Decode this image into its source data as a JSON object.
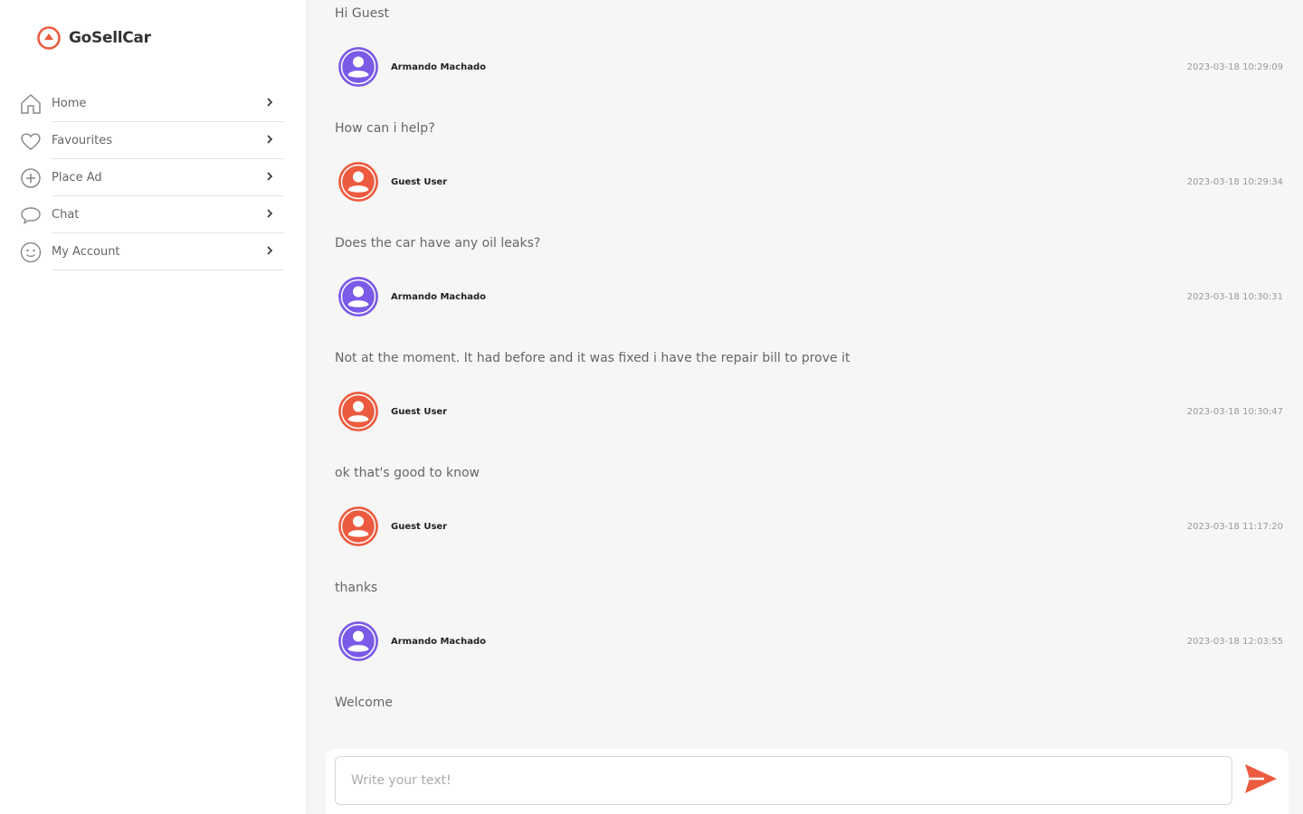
{
  "app": {
    "name": "GoSellCar",
    "accent": "#ec5b3f",
    "secondary": "#7a5ae6"
  },
  "sidebar": {
    "items": [
      {
        "label": "Home",
        "icon": "home-icon"
      },
      {
        "label": "Favourites",
        "icon": "heart-icon"
      },
      {
        "label": "Place Ad",
        "icon": "plus-circle-icon"
      },
      {
        "label": "Chat",
        "icon": "chat-bubble-icon"
      },
      {
        "label": "My Account",
        "icon": "account-icon"
      }
    ]
  },
  "chat": {
    "messages": [
      {
        "text": "Hi Guest",
        "author": "Armando Machado",
        "timestamp": "2023-03-18 10:29:09",
        "role": "seller"
      },
      {
        "text": "How can i help?",
        "author": "Guest User",
        "timestamp": "2023-03-18 10:29:34",
        "role": "guest"
      },
      {
        "text": "Does the car have any oil leaks?",
        "author": "Armando Machado",
        "timestamp": "2023-03-18 10:30:31",
        "role": "seller"
      },
      {
        "text": "Not at the moment. It had before and it was fixed i have the repair bill to prove it",
        "author": "Guest User",
        "timestamp": "2023-03-18 10:30:47",
        "role": "guest"
      },
      {
        "text": "ok that's good to know",
        "author": "Guest User",
        "timestamp": "2023-03-18 11:17:20",
        "role": "guest"
      },
      {
        "text": "thanks",
        "author": "Armando Machado",
        "timestamp": "2023-03-18 12:03:55",
        "role": "seller"
      }
    ],
    "last_message": "Welcome"
  },
  "composer": {
    "placeholder": "Write your text!",
    "value": ""
  }
}
